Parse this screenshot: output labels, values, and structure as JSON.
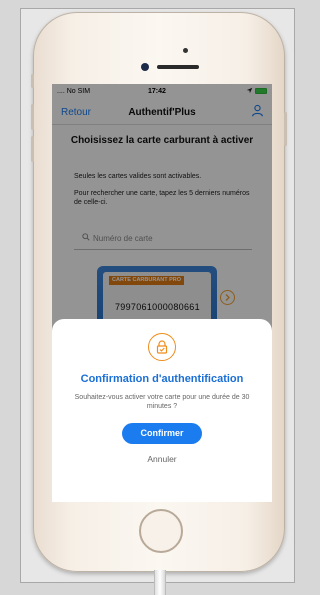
{
  "status_bar": {
    "carrier": ".... No SIM",
    "time": "17:42"
  },
  "nav": {
    "back_label": "Retour",
    "title": "Authentif'Plus",
    "user_icon": "user-icon"
  },
  "page": {
    "heading": "Choisissez la carte carburant à activer",
    "info_1": "Seules les cartes valides sont activables.",
    "info_2": "Pour rechercher une carte, tapez les 5 derniers numéros de celle-ci.",
    "search_placeholder": "Numéro de carte"
  },
  "card": {
    "label": "CARTE CARBURANT PRO",
    "number": "7997061000080661"
  },
  "modal": {
    "icon": "lock-icon",
    "title": "Confirmation d'authentification",
    "message": "Souhaitez-vous activer votre carte pour une durée de 30 minutes ?",
    "confirm_label": "Confirmer",
    "cancel_label": "Annuler"
  },
  "colors": {
    "accent": "#1b7cf0",
    "orange": "#f08c1a",
    "card_blue": "#2a6fc6"
  }
}
